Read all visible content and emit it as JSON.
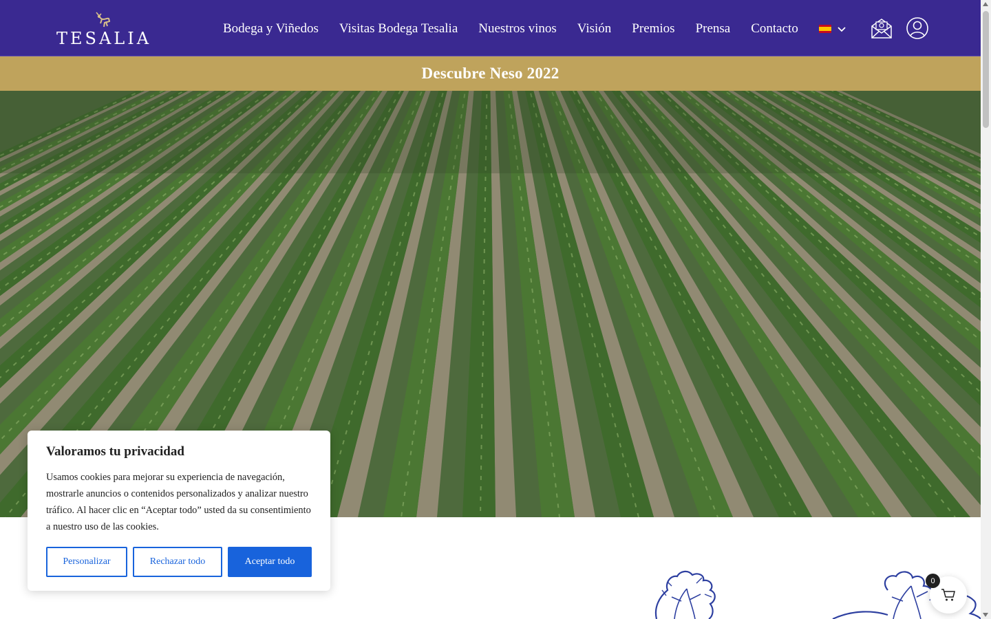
{
  "brand": {
    "name": "TESALIA"
  },
  "nav": {
    "items": [
      {
        "label": "Bodega y Viñedos"
      },
      {
        "label": "Visitas Bodega Tesalia"
      },
      {
        "label": "Nuestros vinos"
      },
      {
        "label": "Visión"
      },
      {
        "label": "Premios"
      },
      {
        "label": "Prensa"
      },
      {
        "label": "Contacto"
      }
    ],
    "language_flag": "spain-flag-icon"
  },
  "header_icons": [
    "newsletter-mail-icon",
    "user-account-icon"
  ],
  "announcement": {
    "text": "Descubre Neso 2022"
  },
  "cookie": {
    "title": "Valoramos tu privacidad",
    "text": "Usamos cookies para mejorar su experiencia de navegación, mostrarle anuncios o contenidos personalizados y analizar nuestro tráfico. Al hacer clic en “Aceptar todo” usted da su consentimiento a nuestro uso de las cookies.",
    "buttons": {
      "customize": "Personalizar",
      "reject": "Rechazar todo",
      "accept": "Aceptar todo"
    }
  },
  "cart": {
    "count": "0"
  },
  "colors": {
    "header_bg": "#3a2991",
    "announce_bg": "#bfa35c",
    "cookie_accent": "#1863dc"
  }
}
